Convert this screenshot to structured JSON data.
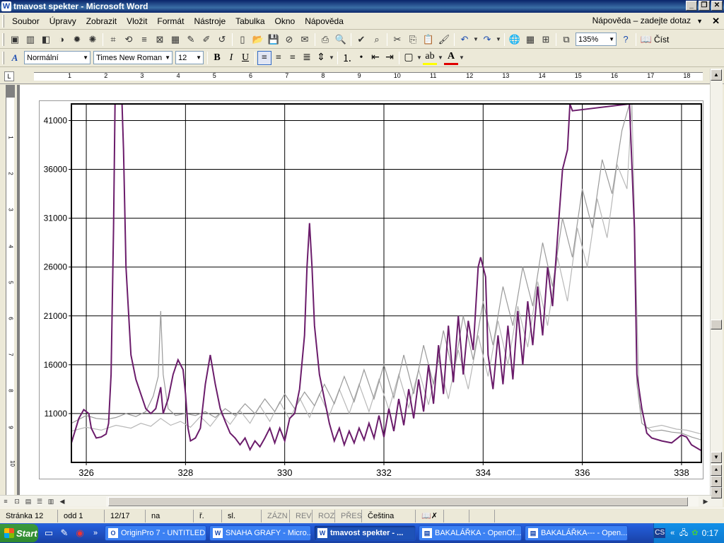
{
  "window": {
    "title": "tmavost spekter - Microsoft Word",
    "app_icon": "word-icon"
  },
  "menu": {
    "items": [
      "Soubor",
      "Úpravy",
      "Zobrazit",
      "Vložit",
      "Formát",
      "Nástroje",
      "Tabulka",
      "Okno",
      "Nápověda"
    ],
    "help_box": "Nápověda – zadejte dotaz"
  },
  "toolbar_standard": {
    "zoom": "135%",
    "read_label": "Číst"
  },
  "toolbar_format": {
    "style": "Normální",
    "font": "Times New Roman",
    "size": "12"
  },
  "ruler": {
    "numbers": [
      "1",
      "2",
      "3",
      "4",
      "5",
      "6",
      "7",
      "8",
      "9",
      "10",
      "11",
      "12",
      "13",
      "14",
      "15",
      "16",
      "17",
      "18"
    ]
  },
  "vruler": {
    "numbers": [
      "1",
      "2",
      "3",
      "4",
      "5",
      "6",
      "7",
      "8",
      "9",
      "10"
    ]
  },
  "status": {
    "page": "Stránka 12",
    "section": "odd 1",
    "pages": "12/17",
    "at": "na",
    "line": "ř.",
    "col": "sl.",
    "rec": "ZÁZN",
    "trk": "REV",
    "ext": "ROZ",
    "ovr": "PŘES",
    "lang": "Čeština"
  },
  "taskbar": {
    "start": "Start",
    "tasks": [
      "OriginPro 7 - UNTITLED",
      "SNAHA GRAFY - Micro...",
      "tmavost spekter - ...",
      "BAKALÁŘKA - OpenOf...",
      "BAKALÁŘKA--- - Open..."
    ],
    "lang_indicator": "CS",
    "clock": "0:17"
  },
  "chart_data": {
    "type": "line",
    "xlim": [
      325.7,
      338.4
    ],
    "ylim": [
      6000,
      42700
    ],
    "xticks": [
      326,
      328,
      330,
      332,
      334,
      336,
      338
    ],
    "yticks": [
      11000,
      16000,
      21000,
      26000,
      31000,
      36000,
      41000
    ],
    "grid": true,
    "series": [
      {
        "color": "#6b1c6b",
        "points": [
          [
            325.7,
            8000
          ],
          [
            325.85,
            10500
          ],
          [
            325.95,
            11400
          ],
          [
            326.05,
            11000
          ],
          [
            326.1,
            9500
          ],
          [
            326.2,
            8500
          ],
          [
            326.3,
            8600
          ],
          [
            326.4,
            8900
          ],
          [
            326.45,
            10000
          ],
          [
            326.5,
            15000
          ],
          [
            326.55,
            30000
          ],
          [
            326.58,
            42700
          ],
          [
            326.72,
            42700
          ],
          [
            326.75,
            38000
          ],
          [
            326.8,
            26000
          ],
          [
            326.9,
            17000
          ],
          [
            327.0,
            14500
          ],
          [
            327.1,
            13000
          ],
          [
            327.2,
            11500
          ],
          [
            327.3,
            11000
          ],
          [
            327.4,
            11500
          ],
          [
            327.5,
            13700
          ],
          [
            327.55,
            11000
          ],
          [
            327.65,
            12500
          ],
          [
            327.75,
            15000
          ],
          [
            327.85,
            16500
          ],
          [
            327.95,
            15500
          ],
          [
            328.0,
            13000
          ],
          [
            328.05,
            9500
          ],
          [
            328.1,
            8200
          ],
          [
            328.2,
            8500
          ],
          [
            328.3,
            9500
          ],
          [
            328.4,
            14000
          ],
          [
            328.5,
            17000
          ],
          [
            328.6,
            14000
          ],
          [
            328.7,
            11500
          ],
          [
            328.8,
            10200
          ],
          [
            328.9,
            9000
          ],
          [
            329.0,
            8500
          ],
          [
            329.1,
            7800
          ],
          [
            329.2,
            8500
          ],
          [
            329.3,
            7300
          ],
          [
            329.4,
            8200
          ],
          [
            329.5,
            7600
          ],
          [
            329.6,
            8500
          ],
          [
            329.7,
            9500
          ],
          [
            329.8,
            8000
          ],
          [
            329.9,
            9500
          ],
          [
            330.0,
            8200
          ],
          [
            330.1,
            10500
          ],
          [
            330.2,
            11000
          ],
          [
            330.3,
            13500
          ],
          [
            330.4,
            19000
          ],
          [
            330.45,
            26000
          ],
          [
            330.5,
            30500
          ],
          [
            330.55,
            26000
          ],
          [
            330.6,
            20000
          ],
          [
            330.7,
            15000
          ],
          [
            330.8,
            12500
          ],
          [
            330.9,
            10000
          ],
          [
            331.0,
            8200
          ],
          [
            331.1,
            9500
          ],
          [
            331.2,
            7800
          ],
          [
            331.3,
            9200
          ],
          [
            331.4,
            8000
          ],
          [
            331.5,
            9500
          ],
          [
            331.6,
            8300
          ],
          [
            331.7,
            10000
          ],
          [
            331.8,
            8500
          ],
          [
            331.9,
            10800
          ],
          [
            332.0,
            8600
          ],
          [
            332.1,
            11500
          ],
          [
            332.2,
            9200
          ],
          [
            332.3,
            12500
          ],
          [
            332.4,
            9800
          ],
          [
            332.5,
            13500
          ],
          [
            332.6,
            10500
          ],
          [
            332.7,
            14500
          ],
          [
            332.8,
            11200
          ],
          [
            332.9,
            16000
          ],
          [
            333.0,
            12000
          ],
          [
            333.1,
            18000
          ],
          [
            333.2,
            13000
          ],
          [
            333.3,
            20000
          ],
          [
            333.4,
            14200
          ],
          [
            333.5,
            21000
          ],
          [
            333.6,
            15000
          ],
          [
            333.7,
            20500
          ],
          [
            333.8,
            17500
          ],
          [
            333.9,
            26000
          ],
          [
            333.95,
            27000
          ],
          [
            334.05,
            25000
          ],
          [
            334.1,
            17000
          ],
          [
            334.2,
            13500
          ],
          [
            334.3,
            19000
          ],
          [
            334.4,
            14000
          ],
          [
            334.5,
            20000
          ],
          [
            334.6,
            14500
          ],
          [
            334.7,
            21500
          ],
          [
            334.8,
            16000
          ],
          [
            334.9,
            22500
          ],
          [
            335.0,
            18000
          ],
          [
            335.1,
            24000
          ],
          [
            335.2,
            19000
          ],
          [
            335.3,
            26000
          ],
          [
            335.4,
            22000
          ],
          [
            335.5,
            29000
          ],
          [
            335.6,
            36000
          ],
          [
            335.7,
            38000
          ],
          [
            335.75,
            42700
          ],
          [
            335.8,
            42000
          ],
          [
            336.95,
            42700
          ],
          [
            337.05,
            30000
          ],
          [
            337.1,
            15000
          ],
          [
            337.2,
            11500
          ],
          [
            337.3,
            9000
          ],
          [
            337.4,
            8500
          ],
          [
            337.6,
            8200
          ],
          [
            337.8,
            8000
          ],
          [
            338.0,
            8800
          ],
          [
            338.1,
            8600
          ],
          [
            338.2,
            7800
          ],
          [
            338.4,
            7200
          ]
        ]
      },
      {
        "color": "#9a9a9a",
        "points": [
          [
            325.7,
            10000
          ],
          [
            326.0,
            10800
          ],
          [
            326.2,
            10500
          ],
          [
            326.4,
            10400
          ],
          [
            326.6,
            10600
          ],
          [
            326.8,
            11000
          ],
          [
            327.0,
            10700
          ],
          [
            327.2,
            11200
          ],
          [
            327.35,
            12800
          ],
          [
            327.45,
            14800
          ],
          [
            327.5,
            21500
          ],
          [
            327.55,
            15000
          ],
          [
            327.65,
            11500
          ],
          [
            327.8,
            10800
          ],
          [
            328.0,
            11000
          ],
          [
            328.2,
            10800
          ],
          [
            328.4,
            11200
          ],
          [
            328.6,
            10600
          ],
          [
            328.8,
            11500
          ],
          [
            329.0,
            10800
          ],
          [
            329.2,
            12000
          ],
          [
            329.4,
            11000
          ],
          [
            329.6,
            12500
          ],
          [
            329.8,
            11200
          ],
          [
            330.0,
            13000
          ],
          [
            330.2,
            11500
          ],
          [
            330.4,
            13200
          ],
          [
            330.6,
            11800
          ],
          [
            330.8,
            14000
          ],
          [
            331.0,
            12000
          ],
          [
            331.2,
            14800
          ],
          [
            331.4,
            12200
          ],
          [
            331.6,
            15500
          ],
          [
            331.8,
            12500
          ],
          [
            332.0,
            16000
          ],
          [
            332.2,
            12600
          ],
          [
            332.4,
            17000
          ],
          [
            332.6,
            13000
          ],
          [
            332.8,
            18000
          ],
          [
            333.0,
            14000
          ],
          [
            333.2,
            19500
          ],
          [
            333.4,
            15000
          ],
          [
            333.6,
            21000
          ],
          [
            333.8,
            16500
          ],
          [
            334.0,
            22500
          ],
          [
            334.2,
            18000
          ],
          [
            334.4,
            24000
          ],
          [
            334.6,
            20000
          ],
          [
            334.8,
            26000
          ],
          [
            335.0,
            22000
          ],
          [
            335.2,
            28500
          ],
          [
            335.4,
            24000
          ],
          [
            335.6,
            31000
          ],
          [
            335.8,
            27000
          ],
          [
            336.0,
            34000
          ],
          [
            336.2,
            30000
          ],
          [
            336.4,
            37000
          ],
          [
            336.6,
            33500
          ],
          [
            336.8,
            40000
          ],
          [
            336.95,
            42700
          ],
          [
            337.05,
            30000
          ],
          [
            337.1,
            14000
          ],
          [
            337.2,
            10000
          ],
          [
            337.4,
            9200
          ],
          [
            337.6,
            9300
          ],
          [
            337.8,
            9100
          ],
          [
            338.0,
            9000
          ],
          [
            338.2,
            8600
          ],
          [
            338.4,
            8300
          ]
        ]
      },
      {
        "color": "#b8b8b8",
        "points": [
          [
            325.7,
            9200
          ],
          [
            326.0,
            9600
          ],
          [
            326.3,
            9300
          ],
          [
            326.6,
            9800
          ],
          [
            326.9,
            9500
          ],
          [
            327.1,
            10000
          ],
          [
            327.3,
            9700
          ],
          [
            327.5,
            10500
          ],
          [
            327.7,
            9800
          ],
          [
            327.9,
            10200
          ],
          [
            328.1,
            9600
          ],
          [
            328.3,
            10700
          ],
          [
            328.5,
            9700
          ],
          [
            328.7,
            11000
          ],
          [
            328.9,
            9900
          ],
          [
            329.1,
            11300
          ],
          [
            329.3,
            10000
          ],
          [
            329.5,
            11800
          ],
          [
            329.7,
            10200
          ],
          [
            329.9,
            12200
          ],
          [
            330.1,
            10400
          ],
          [
            330.3,
            12600
          ],
          [
            330.5,
            10600
          ],
          [
            330.7,
            13000
          ],
          [
            330.9,
            10800
          ],
          [
            331.1,
            13500
          ],
          [
            331.3,
            11000
          ],
          [
            331.5,
            14000
          ],
          [
            331.7,
            11200
          ],
          [
            331.9,
            14500
          ],
          [
            332.1,
            11400
          ],
          [
            332.3,
            15000
          ],
          [
            332.5,
            11600
          ],
          [
            332.7,
            15500
          ],
          [
            332.9,
            11900
          ],
          [
            333.1,
            16500
          ],
          [
            333.3,
            12500
          ],
          [
            333.5,
            17500
          ],
          [
            333.7,
            13500
          ],
          [
            333.9,
            19000
          ],
          [
            334.1,
            14800
          ],
          [
            334.3,
            20500
          ],
          [
            334.5,
            16000
          ],
          [
            334.7,
            22000
          ],
          [
            334.9,
            17800
          ],
          [
            335.1,
            24500
          ],
          [
            335.3,
            20000
          ],
          [
            335.5,
            27000
          ],
          [
            335.7,
            22500
          ],
          [
            335.9,
            30000
          ],
          [
            336.1,
            26000
          ],
          [
            336.3,
            33000
          ],
          [
            336.5,
            29000
          ],
          [
            336.7,
            36500
          ],
          [
            336.9,
            34000
          ],
          [
            337.0,
            42700
          ],
          [
            337.08,
            25000
          ],
          [
            337.15,
            12000
          ],
          [
            337.3,
            9500
          ],
          [
            337.6,
            9800
          ],
          [
            337.9,
            9400
          ],
          [
            338.1,
            9300
          ],
          [
            338.4,
            8900
          ]
        ]
      }
    ]
  }
}
